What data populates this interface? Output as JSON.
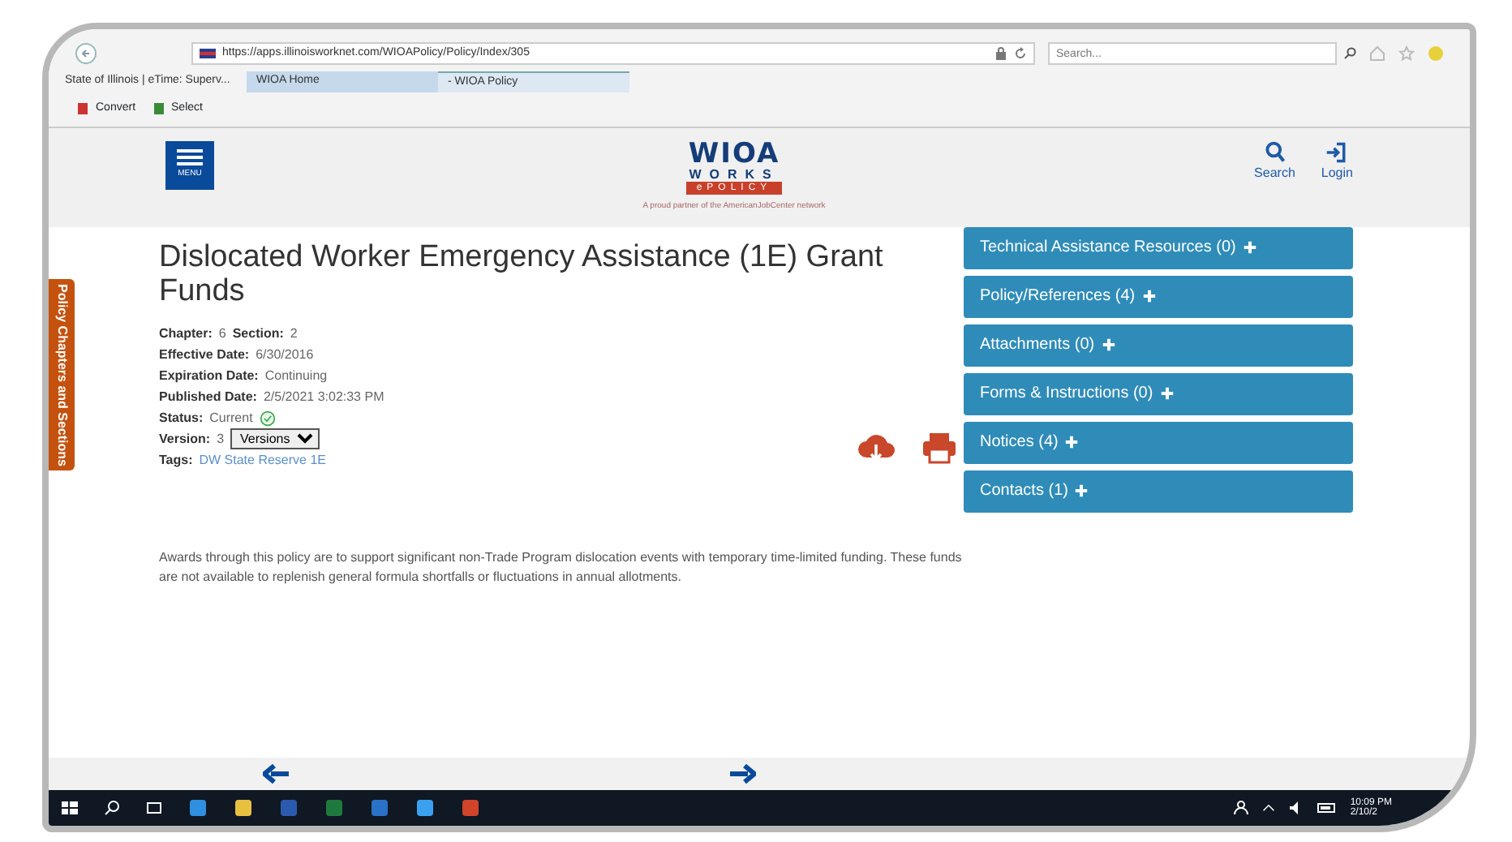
{
  "browser": {
    "url": "https://apps.illinoisworknet.com/WIOAPolicy/Policy/Index/305",
    "search_placeholder": "Search...",
    "tabs": [
      {
        "label": "State of Illinois | eTime: Superv...",
        "selected": false
      },
      {
        "label": "WIOA Home",
        "selected": false
      },
      {
        "label": "- WIOA Policy",
        "selected": true
      }
    ],
    "toolbar": [
      "Convert",
      "Select"
    ]
  },
  "header": {
    "menu_label": "MENU",
    "logo": {
      "word": "WIOA",
      "sub": "WORKS",
      "band": "ePOLICY",
      "tagline": "A proud partner of the AmericanJobCenter network"
    },
    "actions": [
      {
        "label": "Search",
        "kind": "search"
      },
      {
        "label": "Login",
        "kind": "login"
      }
    ]
  },
  "side_tab": "Policy Chapters and Sections",
  "policy": {
    "title": "Dislocated Worker Emergency Assistance (1E) Grant Funds",
    "meta": [
      {
        "kind": "pair",
        "items": [
          {
            "label": "Chapter:",
            "value": "6"
          },
          {
            "label": "Section:",
            "value": "2"
          }
        ]
      },
      {
        "kind": "pair",
        "items": [
          {
            "label": "Effective Date:",
            "value": "6/30/2016"
          }
        ]
      },
      {
        "kind": "pair",
        "items": [
          {
            "label": "Expiration Date:",
            "value": "Continuing"
          }
        ]
      },
      {
        "kind": "pair",
        "items": [
          {
            "label": "Published Date:",
            "value": "2/5/2021 3:02:33 PM"
          }
        ]
      },
      {
        "kind": "status",
        "label": "Status:",
        "value": "Current"
      },
      {
        "kind": "version",
        "label": "Version:",
        "value": "3",
        "select": "Versions"
      },
      {
        "kind": "tags",
        "label": "Tags:",
        "value": "DW State Reserve 1E"
      }
    ],
    "description": "Awards through this policy are to support significant non-Trade Program dislocation events with temporary time-limited funding.  These funds are not available to replenish general formula shortfalls or fluctuations in annual allotments."
  },
  "accordion": [
    {
      "label": "Technical Assistance Resources (0)",
      "expanded": false
    },
    {
      "label": "Policy/References (4)",
      "expanded": false
    },
    {
      "label": "Attachments (0)",
      "expanded": false
    },
    {
      "label": "Forms & Instructions (0)",
      "expanded": false
    },
    {
      "label": "Notices (4)",
      "expanded": false
    },
    {
      "label": "Contacts (1)",
      "expanded": false
    }
  ],
  "taskbar": {
    "time": "10:09 PM",
    "date": "2/10/2"
  }
}
